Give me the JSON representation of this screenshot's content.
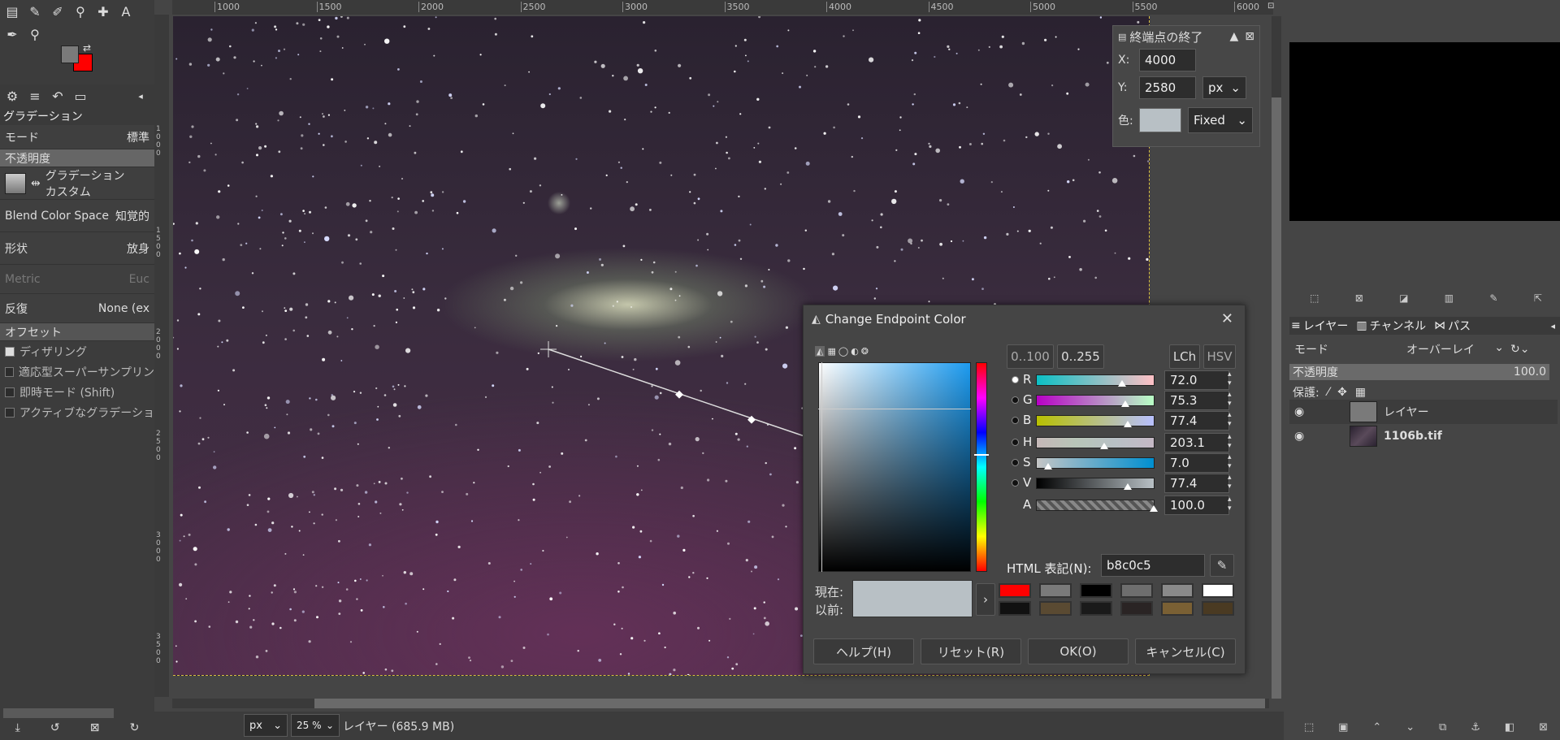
{
  "toolbox": {
    "tool_icons": [
      "gradient-icon",
      "pencil-icon",
      "smudge-icon",
      "clone-icon",
      "heal-icon",
      "text-icon",
      "eyedropper-icon",
      "zoom-icon"
    ],
    "tabs_icons": [
      "tool-options-icon",
      "device-status-icon",
      "undo-history-icon",
      "images-icon"
    ],
    "tool_name": "グラデーション",
    "mode_label": "モード",
    "mode_value": "標準",
    "opacity_label": "不透明度",
    "gradient_label": "グラデーション",
    "gradient_value": "カスタム",
    "blend_label": "Blend Color Space",
    "blend_value": "知覚的",
    "shape_label": "形状",
    "shape_value": "放身",
    "metric_label": "Metric",
    "metric_value": "Euc",
    "repeat_label": "反復",
    "repeat_value": "None (ex",
    "offset_label": "オフセット",
    "dither_label": "ディザリング",
    "supersample_label": "適応型スーパーサンプリン",
    "instant_label": "即時モード  (Shift)",
    "active_label": "アクティブなグラデーショ"
  },
  "ruler": {
    "labels": [
      "1000",
      "1500",
      "2000",
      "2500",
      "3000",
      "3500",
      "4000",
      "4500",
      "5000",
      "5500",
      "6000"
    ],
    "vlabels": [
      "1000",
      "1500",
      "2000",
      "2500",
      "3000",
      "3500"
    ]
  },
  "endpoint_panel": {
    "title": "終端点の終了",
    "x_label": "X:",
    "x_value": "4000",
    "y_label": "Y:",
    "y_value": "2580",
    "unit": "px",
    "color_label": "色:",
    "color_mode": "Fixed",
    "color": "#b8c0c5"
  },
  "layers_dock": {
    "tabs": [
      "レイヤー",
      "チャンネル",
      "パス"
    ],
    "mode_label": "モード",
    "mode_value": "オーバーレイ",
    "opacity_label": "不透明度",
    "opacity_value": "100.0",
    "lock_label": "保護:",
    "layers": [
      {
        "name": "レイヤー"
      },
      {
        "name": "1106b.tif"
      }
    ]
  },
  "dialog": {
    "title": "Change Endpoint Color",
    "range_100": "0..100",
    "range_255": "0..255",
    "lch": "LCh",
    "hsv": "HSV",
    "channels": [
      {
        "label": "R",
        "value": "72.0",
        "pos": 0.72
      },
      {
        "label": "G",
        "value": "75.3",
        "pos": 0.753
      },
      {
        "label": "B",
        "value": "77.4",
        "pos": 0.774
      },
      {
        "label": "H",
        "value": "203.1",
        "pos": 0.564
      },
      {
        "label": "S",
        "value": "7.0",
        "pos": 0.07
      },
      {
        "label": "V",
        "value": "77.4",
        "pos": 0.774
      },
      {
        "label": "A",
        "value": "100.0",
        "pos": 1.0
      }
    ],
    "html_label": "HTML 表記(N):",
    "html_value": "b8c0c5",
    "current_label": "現在:",
    "previous_label": "以前:",
    "swatch_colors": [
      "#ff0000",
      "#7a7a7a",
      "#000000",
      "#6e6e6e",
      "#8a8a8a",
      "#ffffff",
      "#111111",
      "#5a4a32",
      "#1a1a1a",
      "#2a2424",
      "#7a6034",
      "#4a3a22"
    ],
    "help": "ヘルプ(H)",
    "reset": "リセット(R)",
    "ok": "OK(O)",
    "cancel": "キャンセル(C)"
  },
  "status": {
    "unit": "px",
    "zoom": "25 %",
    "info": "レイヤー (685.9 MB)"
  }
}
